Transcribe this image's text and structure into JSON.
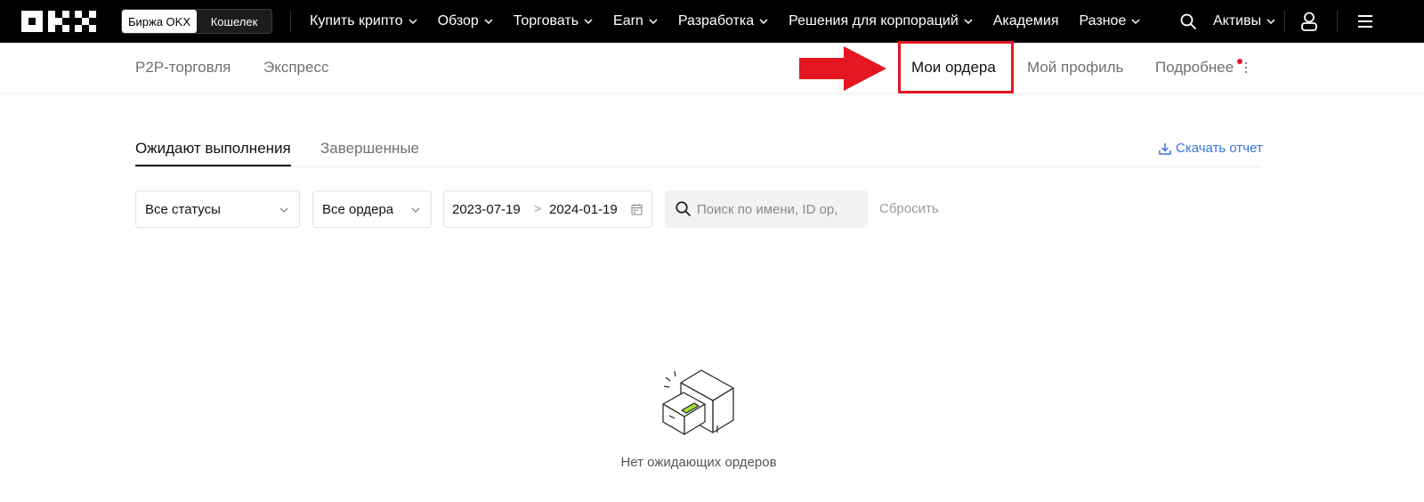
{
  "header": {
    "logo_text": "OKX",
    "switch": {
      "exchange": "Биржа OKX",
      "wallet": "Кошелек"
    },
    "nav": [
      {
        "label": "Купить крипто",
        "dropdown": true
      },
      {
        "label": "Обзор",
        "dropdown": true
      },
      {
        "label": "Торговать",
        "dropdown": true
      },
      {
        "label": "Earn",
        "dropdown": true
      },
      {
        "label": "Разработка",
        "dropdown": true
      },
      {
        "label": "Решения для корпораций",
        "dropdown": true
      },
      {
        "label": "Академия",
        "dropdown": false
      },
      {
        "label": "Разное",
        "dropdown": true
      }
    ],
    "assets_label": "Активы",
    "icons": {
      "search": "search-icon",
      "user": "user-icon",
      "menu": "menu-icon"
    }
  },
  "subnav": {
    "p2p": "P2P-торговля",
    "express": "Экспресс",
    "my_orders": "Мои ордера",
    "my_profile": "Мой профиль",
    "more": "Подробнее"
  },
  "tabs": {
    "pending": "Ожидают выполнения",
    "completed": "Завершенные",
    "download": "Скачать отчет"
  },
  "filters": {
    "status": "Все статусы",
    "orders": "Все ордера",
    "date_from": "2023-07-19",
    "date_sep": ">",
    "date_to": "2024-01-19",
    "search_placeholder": "Поиск по имени, ID ор,",
    "reset": "Сбросить"
  },
  "empty": {
    "message": "Нет ожидающих ордеров"
  },
  "colors": {
    "accent_link": "#3a74e0",
    "highlight": "#e4161f",
    "topbar": "#000000"
  }
}
